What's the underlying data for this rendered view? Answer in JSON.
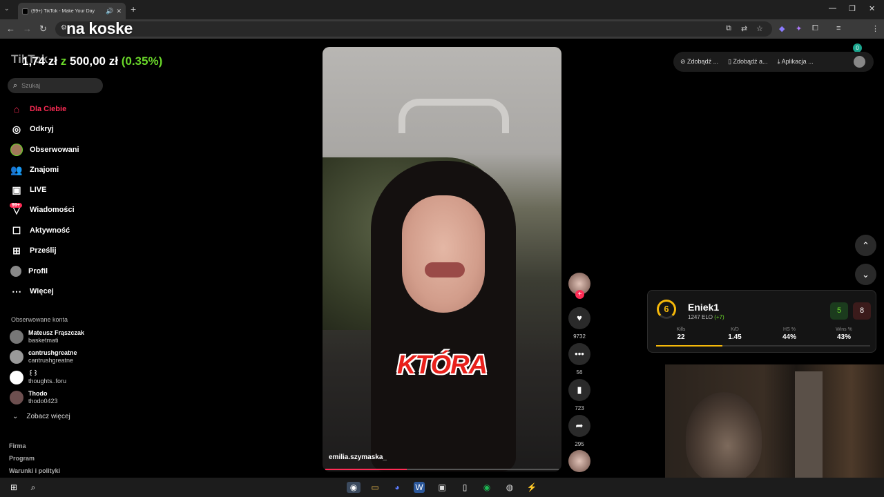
{
  "browser": {
    "tab_title": "(99+) TikTok - Make Your Day",
    "overlay_title": "na koske"
  },
  "stream": {
    "balance_prefix": "1,74 zł",
    "balance_mid": "z",
    "balance_target": "500,00 zł",
    "balance_pct": "(0.35%)"
  },
  "tiktok": {
    "logo": "TikTok",
    "search_placeholder": "Szukaj",
    "nav": [
      {
        "label": "Dla Ciebie",
        "icon": "home-icon"
      },
      {
        "label": "Odkryj",
        "icon": "compass-icon"
      },
      {
        "label": "Obserwowani",
        "icon": "following-avatar-icon"
      },
      {
        "label": "Znajomi",
        "icon": "friends-icon"
      },
      {
        "label": "LIVE",
        "icon": "live-icon"
      },
      {
        "label": "Wiadomości",
        "icon": "messages-icon"
      },
      {
        "label": "Aktywność",
        "icon": "activity-icon"
      },
      {
        "label": "Prześlij",
        "icon": "upload-icon"
      },
      {
        "label": "Profil",
        "icon": "profile-icon"
      },
      {
        "label": "Więcej",
        "icon": "more-icon"
      }
    ],
    "messages_badge": "99+",
    "followed_heading": "Obserwowane konta",
    "followed": [
      {
        "name": "Mateusz Frąszczak",
        "handle": "basketmati"
      },
      {
        "name": "cantrushgreatne",
        "handle": "cantrushgreatne"
      },
      {
        "name": "꒰꒱",
        "handle": "thoughts..foru"
      },
      {
        "name": "Thodo",
        "handle": "thodo0423"
      }
    ],
    "see_more": "Zobacz więcej",
    "footer": [
      "Firma",
      "Program",
      "Warunki i polityki"
    ],
    "top_buttons": [
      "Zdobądź ...",
      "Zdobądź a...",
      "Aplikacja ..."
    ],
    "video": {
      "caption": "KTÓRA",
      "username": "emilia.szymaska_",
      "progress": 0.35
    },
    "actions": {
      "likes": "9732",
      "comments": "56",
      "saves": "723",
      "shares": "295"
    }
  },
  "faceit": {
    "level": "6",
    "name": "Eniek1",
    "elo": "1247 ELO",
    "elo_delta": "(+7)",
    "wins": "5",
    "losses": "8",
    "stats": [
      {
        "label": "Kills",
        "value": "22"
      },
      {
        "label": "K/D",
        "value": "1.45"
      },
      {
        "label": "HS %",
        "value": "44%"
      },
      {
        "label": "Wins %",
        "value": "43%"
      }
    ]
  },
  "colors": {
    "accent": "#fe2c55",
    "green": "#6bd92a",
    "faceit_level": "#f5b80a"
  }
}
